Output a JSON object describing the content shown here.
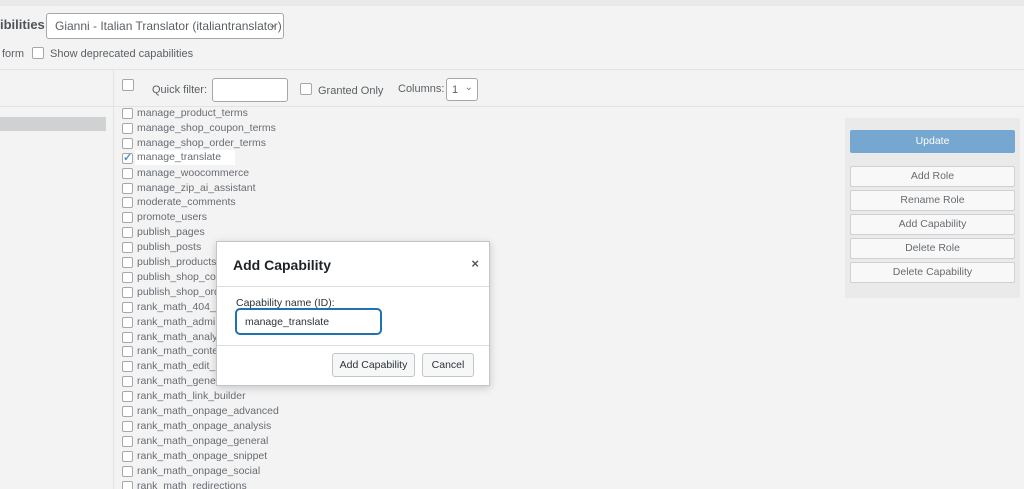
{
  "header": {
    "capabilities_label": "ibilities:",
    "role_selected": "Gianni - Italian Translator (italiantranslator)",
    "form_text": "form",
    "show_deprecated_label": "Show deprecated capabilities"
  },
  "toolbar": {
    "quick_filter_label": "Quick filter:",
    "quick_filter_value": "",
    "granted_only_label": "Granted Only",
    "columns_label": "Columns:",
    "columns_value": "1"
  },
  "capabilities": [
    {
      "name": "manage_product_terms",
      "checked": false
    },
    {
      "name": "manage_shop_coupon_terms",
      "checked": false
    },
    {
      "name": "manage_shop_order_terms",
      "checked": false
    },
    {
      "name": "manage_translate",
      "checked": true
    },
    {
      "name": "manage_woocommerce",
      "checked": false
    },
    {
      "name": "manage_zip_ai_assistant",
      "checked": false
    },
    {
      "name": "moderate_comments",
      "checked": false
    },
    {
      "name": "promote_users",
      "checked": false
    },
    {
      "name": "publish_pages",
      "checked": false
    },
    {
      "name": "publish_posts",
      "checked": false
    },
    {
      "name": "publish_products",
      "checked": false
    },
    {
      "name": "publish_shop_co",
      "checked": false
    },
    {
      "name": "publish_shop_ord",
      "checked": false
    },
    {
      "name": "rank_math_404_",
      "checked": false
    },
    {
      "name": "rank_math_admi",
      "checked": false
    },
    {
      "name": "rank_math_analy",
      "checked": false
    },
    {
      "name": "rank_math_conte",
      "checked": false
    },
    {
      "name": "rank_math_edit_",
      "checked": false
    },
    {
      "name": "rank_math_gene",
      "checked": false
    },
    {
      "name": "rank_math_link_builder",
      "checked": false
    },
    {
      "name": "rank_math_onpage_advanced",
      "checked": false
    },
    {
      "name": "rank_math_onpage_analysis",
      "checked": false
    },
    {
      "name": "rank_math_onpage_general",
      "checked": false
    },
    {
      "name": "rank_math_onpage_snippet",
      "checked": false
    },
    {
      "name": "rank_math_onpage_social",
      "checked": false
    },
    {
      "name": "rank_math_redirections",
      "checked": false
    }
  ],
  "side_panel": {
    "update": "Update",
    "add_role": "Add Role",
    "rename_role": "Rename Role",
    "add_capability": "Add Capability",
    "delete_role": "Delete Role",
    "delete_capability": "Delete Capability"
  },
  "modal": {
    "title": "Add Capability",
    "close_glyph": "×",
    "field_label": "Capability name (ID):",
    "field_value": "manage_translate",
    "submit": "Add Capability",
    "cancel": "Cancel"
  },
  "colors": {
    "primary": "#4f8fc4",
    "focus": "#2271b1",
    "background": "#f0f0f1"
  }
}
